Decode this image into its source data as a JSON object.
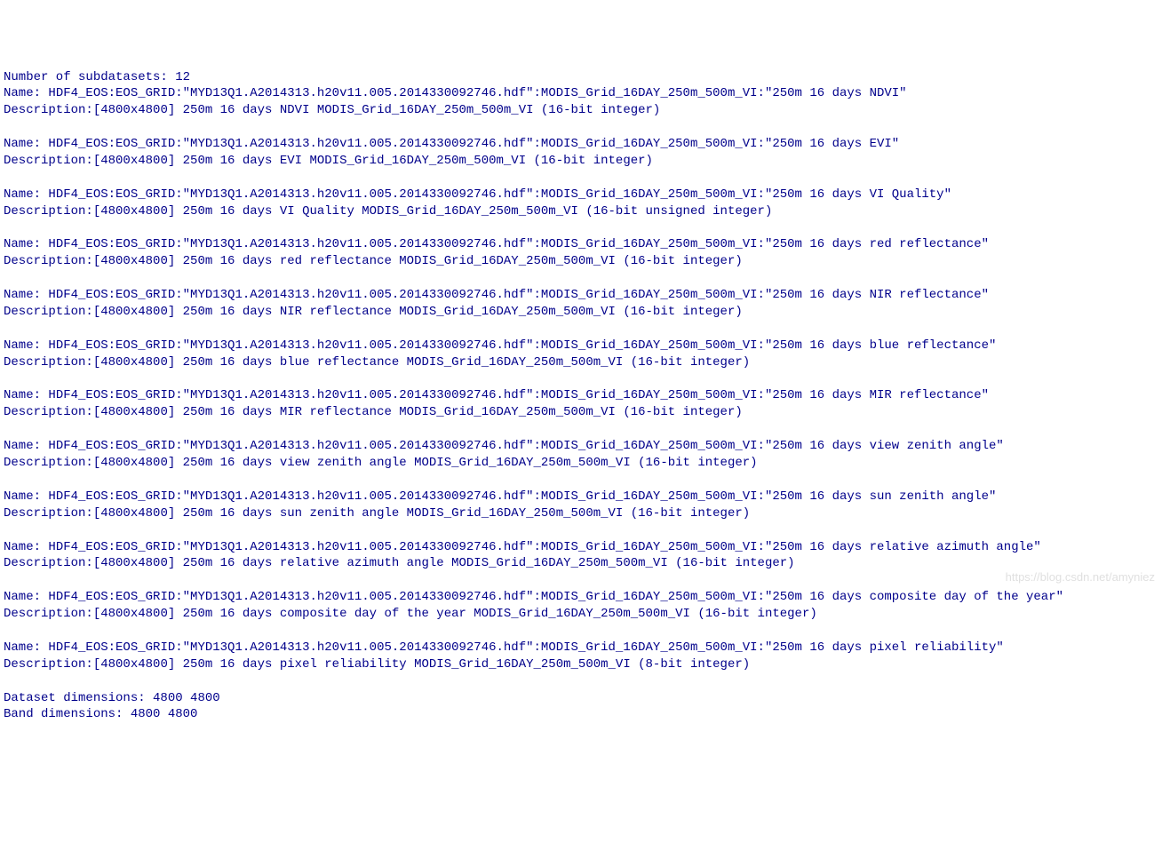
{
  "header": {
    "count_label": "Number of subdatasets: ",
    "count_value": "12"
  },
  "name_prefix": "Name: HDF4_EOS:EOS_GRID:\"MYD13Q1.A2014313.h20v11.005.2014330092746.hdf\":MODIS_Grid_16DAY_250m_500m_VI:",
  "desc_prefix": "Description:",
  "subdatasets": [
    {
      "layer": "\"250m 16 days NDVI\"",
      "desc": "[4800x4800] 250m 16 days NDVI MODIS_Grid_16DAY_250m_500m_VI (16-bit integer)"
    },
    {
      "layer": "\"250m 16 days EVI\"",
      "desc": "[4800x4800] 250m 16 days EVI MODIS_Grid_16DAY_250m_500m_VI (16-bit integer)"
    },
    {
      "layer": "\"250m 16 days VI Quality\"",
      "desc": "[4800x4800] 250m 16 days VI Quality MODIS_Grid_16DAY_250m_500m_VI (16-bit unsigned integer)"
    },
    {
      "layer": "\"250m 16 days red reflectance\"",
      "desc": "[4800x4800] 250m 16 days red reflectance MODIS_Grid_16DAY_250m_500m_VI (16-bit integer)"
    },
    {
      "layer": "\"250m 16 days NIR reflectance\"",
      "desc": "[4800x4800] 250m 16 days NIR reflectance MODIS_Grid_16DAY_250m_500m_VI (16-bit integer)"
    },
    {
      "layer": "\"250m 16 days blue reflectance\"",
      "desc": "[4800x4800] 250m 16 days blue reflectance MODIS_Grid_16DAY_250m_500m_VI (16-bit integer)"
    },
    {
      "layer": "\"250m 16 days MIR reflectance\"",
      "desc": "[4800x4800] 250m 16 days MIR reflectance MODIS_Grid_16DAY_250m_500m_VI (16-bit integer)"
    },
    {
      "layer": "\"250m 16 days view zenith angle\"",
      "desc": "[4800x4800] 250m 16 days view zenith angle MODIS_Grid_16DAY_250m_500m_VI (16-bit integer)"
    },
    {
      "layer": "\"250m 16 days sun zenith angle\"",
      "desc": "[4800x4800] 250m 16 days sun zenith angle MODIS_Grid_16DAY_250m_500m_VI (16-bit integer)"
    },
    {
      "layer": "\"250m 16 days relative azimuth angle\"",
      "desc": "[4800x4800] 250m 16 days relative azimuth angle MODIS_Grid_16DAY_250m_500m_VI (16-bit integer)"
    },
    {
      "layer": "\"250m 16 days composite day of the year\"",
      "desc": "[4800x4800] 250m 16 days composite day of the year MODIS_Grid_16DAY_250m_500m_VI (16-bit integer)"
    },
    {
      "layer": "\"250m 16 days pixel reliability\"",
      "desc": "[4800x4800] 250m 16 days pixel reliability MODIS_Grid_16DAY_250m_500m_VI (8-bit integer)"
    }
  ],
  "footer": {
    "dataset_dim_label": "Dataset dimensions: ",
    "dataset_dim_value": "4800 4800",
    "band_dim_label": "Band dimensions: ",
    "band_dim_value": "4800 4800"
  },
  "watermark": "https://blog.csdn.net/amyniez"
}
